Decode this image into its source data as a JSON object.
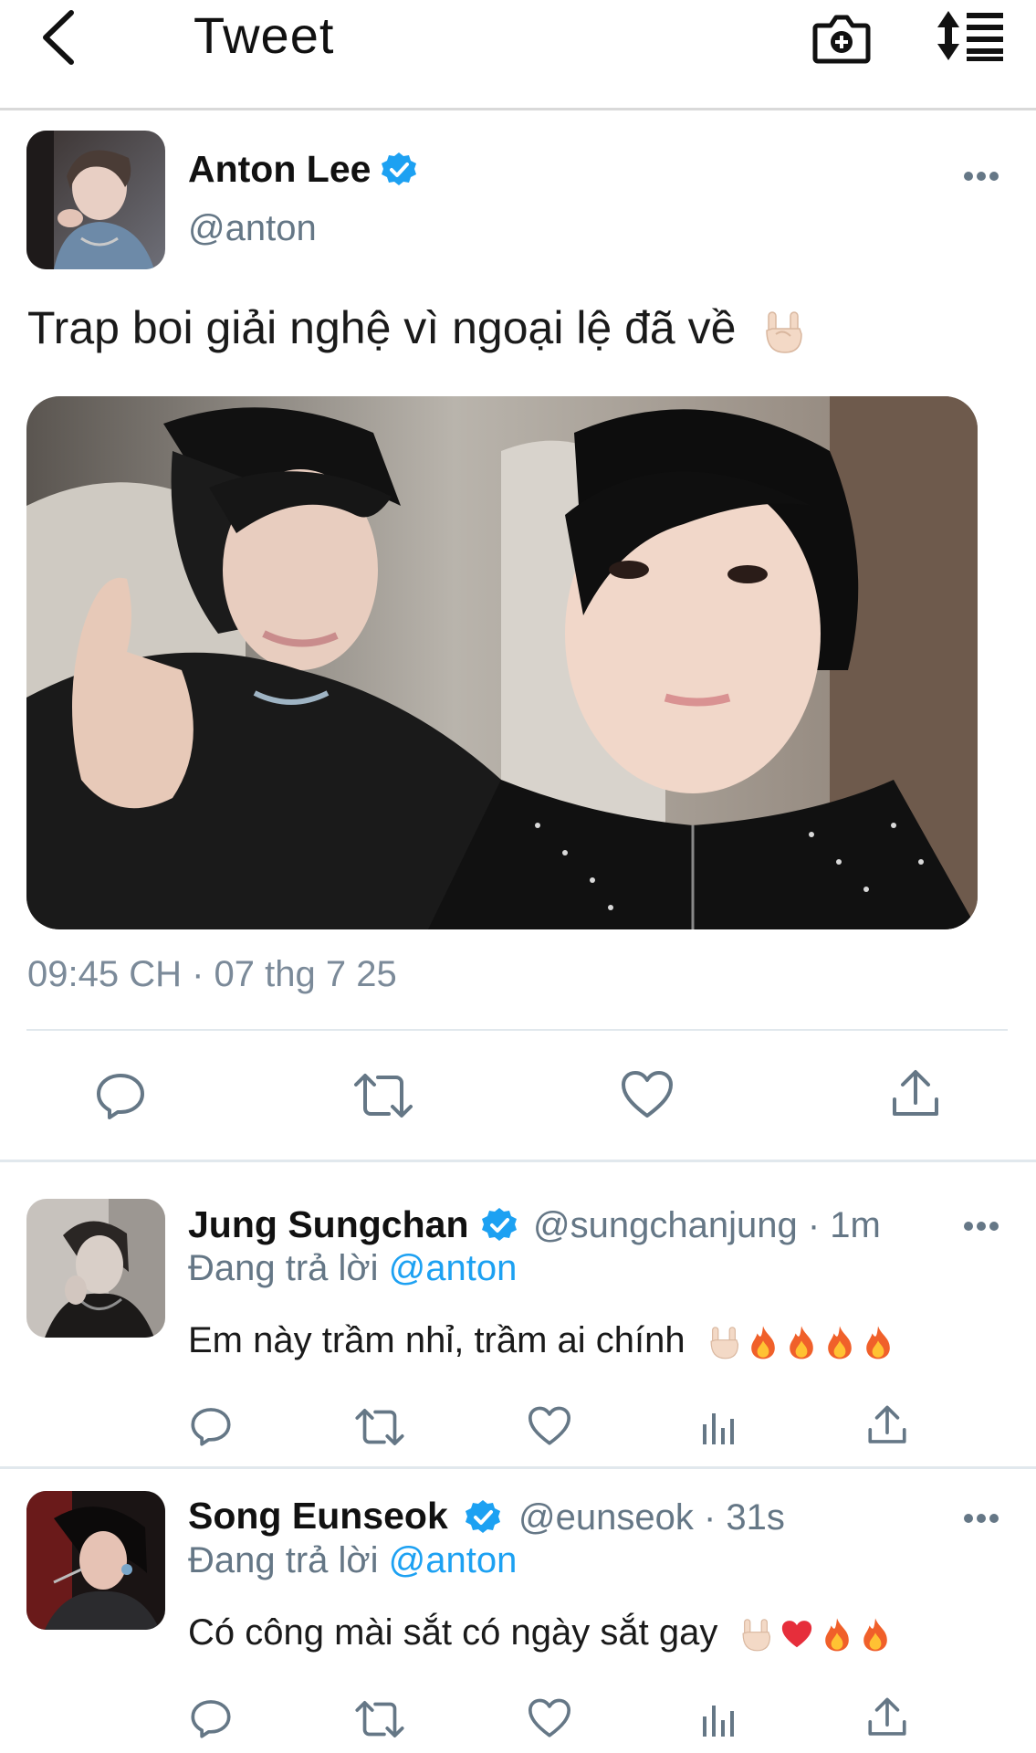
{
  "header": {
    "title": "Tweet"
  },
  "tweet": {
    "author_name": "Anton Lee",
    "author_handle": "@anton",
    "text": "Trap boi giải nghệ vì ngoại lệ đã về",
    "timestamp": "09:45 CH · 07 thg 7 25"
  },
  "replies": [
    {
      "name": "Jung Sungchan",
      "handle_time": "@sungchanjung · 1m",
      "replying_prefix": "Đang trả lời",
      "replying_to": "@anton",
      "text": "Em này trầm nhỉ, trầm ai chính",
      "emojis": [
        "rock-hand",
        "fire",
        "fire",
        "fire",
        "fire"
      ]
    },
    {
      "name": "Song Eunseok",
      "handle_time": "@eunseok · 31s",
      "replying_prefix": "Đang trả lời",
      "replying_to": "@anton",
      "text": "Có công mài sắt có ngày sắt gay",
      "emojis": [
        "rock-hand",
        "red-heart",
        "fire",
        "fire"
      ]
    }
  ],
  "colors": {
    "verified": "#1da1f2",
    "mention": "#1da1f2",
    "icon_gray": "#657786",
    "header_icon": "#111111"
  }
}
